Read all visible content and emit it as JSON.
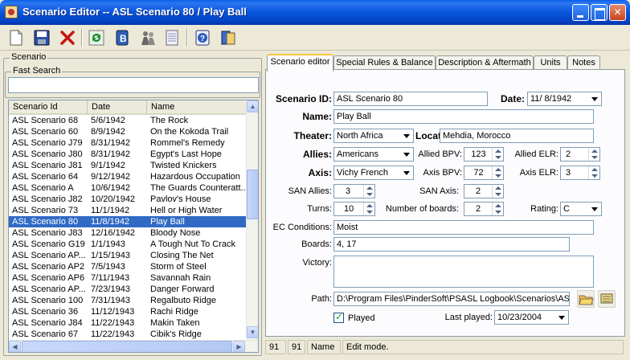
{
  "window": {
    "title": "Scenario Editor -- ASL Scenario 80 / Play Ball"
  },
  "toolbar": {
    "icons": [
      "new-document-icon",
      "save-icon",
      "delete-icon",
      "refresh-icon",
      "book-icon",
      "soldiers-icon",
      "notes-icon",
      "help-icon",
      "about-icon"
    ]
  },
  "left": {
    "group_label": "Scenario",
    "fast_search_label": "Fast Search",
    "fast_search_value": "",
    "columns": [
      "Scenario Id",
      "Date",
      "Name"
    ],
    "rows": [
      [
        "ASL Scenario 68",
        "5/6/1942",
        "The Rock"
      ],
      [
        "ASL Scenario 60",
        "8/9/1942",
        "On the Kokoda Trail"
      ],
      [
        "ASL Scenario J79",
        "8/31/1942",
        "Rommel's Remedy"
      ],
      [
        "ASL Scenario J80",
        "8/31/1942",
        "Egypt's Last Hope"
      ],
      [
        "ASL Scenario J81",
        "9/1/1942",
        "Twisted Knickers"
      ],
      [
        "ASL Scenario 64",
        "9/12/1942",
        "Hazardous Occupation"
      ],
      [
        "ASL Scenario A",
        "10/6/1942",
        "The Guards Counteratt..."
      ],
      [
        "ASL Scenario J82",
        "10/20/1942",
        "Pavlov's House"
      ],
      [
        "ASL Scenario 73",
        "11/1/1942",
        "Hell or High Water"
      ],
      [
        "ASL Scenario 80",
        "11/8/1942",
        "Play Ball"
      ],
      [
        "ASL Scenario J83",
        "12/16/1942",
        "Bloody Nose"
      ],
      [
        "ASL Scenario G19",
        "1/1/1943",
        "A Tough Nut To Crack"
      ],
      [
        "ASL Scenario AP...",
        "1/15/1943",
        "Closing The Net"
      ],
      [
        "ASL Scenario AP2",
        "7/5/1943",
        "Storm of Steel"
      ],
      [
        "ASL Scenario AP6",
        "7/11/1943",
        "Savannah Rain"
      ],
      [
        "ASL Scenario AP...",
        "7/23/1943",
        "Danger Forward"
      ],
      [
        "ASL Scenario 100",
        "7/31/1943",
        "Regalbuto Ridge"
      ],
      [
        "ASL Scenario 36",
        "11/12/1943",
        "Rachi Ridge"
      ],
      [
        "ASL Scenario J84",
        "11/22/1943",
        "Makin Taken"
      ],
      [
        "ASL Scenario 67",
        "11/22/1943",
        "Cibik's Ridge"
      ]
    ],
    "selected_index": 9
  },
  "tabs": [
    "Scenario editor",
    "Special Rules & Balance",
    "Description & Aftermath",
    "Units",
    "Notes"
  ],
  "form": {
    "scenario_id_label": "Scenario ID:",
    "scenario_id": "ASL Scenario 80",
    "date_label": "Date:",
    "date": "11/ 8/1942",
    "name_label": "Name:",
    "name": "Play Ball",
    "theater_label": "Theater:",
    "theater": "North Africa",
    "location_label": "Location:",
    "location": "Mehdia, Morocco",
    "allies_label": "Allies:",
    "allies": "Americans",
    "allied_bpv_label": "Allied BPV:",
    "allied_bpv": "123",
    "allied_elr_label": "Allied ELR:",
    "allied_elr": "2",
    "axis_label": "Axis:",
    "axis": "Vichy French",
    "axis_bpv_label": "Axis BPV:",
    "axis_bpv": "72",
    "axis_elr_label": "Axis ELR:",
    "axis_elr": "3",
    "san_allies_label": "SAN Allies:",
    "san_allies": "3",
    "san_axis_label": "SAN Axis:",
    "san_axis": "2",
    "turns_label": "Turns:",
    "turns": "10",
    "boards_count_label": "Number of boards:",
    "boards_count": "2",
    "rating_label": "Rating:",
    "rating": "C",
    "ec_label": "EC Conditions:",
    "ec": "Moist",
    "boards_label": "Boards:",
    "boards": "4, 17",
    "victory_label": "Victory:",
    "victory": "",
    "path_label": "Path:",
    "path": "D:\\Program Files\\PinderSoft\\PSASL Logbook\\Scenarios\\AS",
    "played_label": "Played",
    "last_played_label": "Last played:",
    "last_played": "10/23/2004"
  },
  "status": {
    "a": "91",
    "b": "91",
    "c": "Name",
    "d": "Edit mode."
  }
}
